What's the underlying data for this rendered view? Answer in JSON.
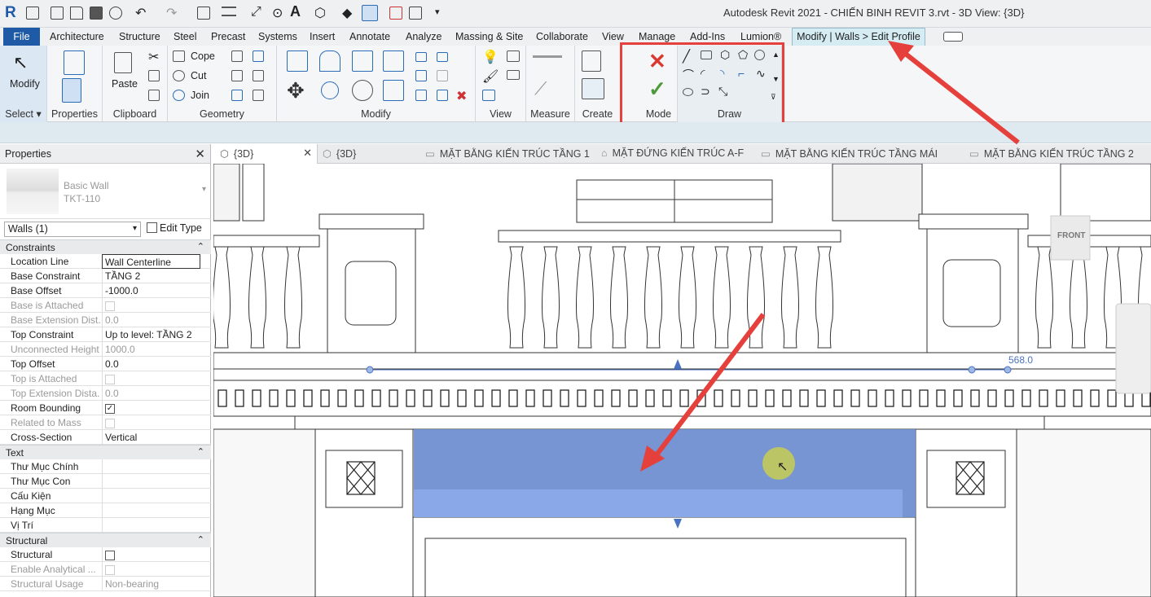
{
  "app": {
    "logo": "R",
    "title": "Autodesk Revit 2021 - CHIẾN BINH REVIT 3.rvt - 3D View: {3D}"
  },
  "ribbon_tabs": [
    "File",
    "Architecture",
    "Structure",
    "Steel",
    "Precast",
    "Systems",
    "Insert",
    "Annotate",
    "Analyze",
    "Massing & Site",
    "Collaborate",
    "View",
    "Manage",
    "Add-Ins",
    "Lumion®"
  ],
  "active_tab": "Modify | Walls > Edit Profile",
  "panels": {
    "select": {
      "modify": "Modify",
      "label": "Select ▾"
    },
    "properties": {
      "label": "Properties"
    },
    "clipboard": {
      "paste": "Paste",
      "label": "Clipboard"
    },
    "geometry": {
      "cope": "Cope",
      "cut": "Cut",
      "join": "Join",
      "label": "Geometry"
    },
    "modify": {
      "label": "Modify"
    },
    "view": {
      "label": "View"
    },
    "measure": {
      "label": "Measure"
    },
    "create": {
      "label": "Create"
    },
    "mode": {
      "label": "Mode"
    },
    "draw": {
      "label": "Draw"
    }
  },
  "properties": {
    "title": "Properties",
    "type_family": "Basic Wall",
    "type_name": "TKT-110",
    "instance": "Walls (1)",
    "edit_type": "Edit Type",
    "sections": [
      {
        "name": "Constraints",
        "rows": [
          {
            "k": "Location Line",
            "v": "Wall Centerline",
            "dis": false
          },
          {
            "k": "Base Constraint",
            "v": "TẦNG 2",
            "dis": false
          },
          {
            "k": "Base Offset",
            "v": "-1000.0",
            "dis": false
          },
          {
            "k": "Base is Attached",
            "v": "",
            "cb": true,
            "dis": true
          },
          {
            "k": "Base Extension Dist...",
            "v": "0.0",
            "dis": true
          },
          {
            "k": "Top Constraint",
            "v": "Up to level: TẦNG 2",
            "dis": false
          },
          {
            "k": "Unconnected Height",
            "v": "1000.0",
            "dis": true
          },
          {
            "k": "Top Offset",
            "v": "0.0",
            "dis": false
          },
          {
            "k": "Top is Attached",
            "v": "",
            "cb": true,
            "dis": true
          },
          {
            "k": "Top Extension Dista...",
            "v": "0.0",
            "dis": true
          },
          {
            "k": "Room Bounding",
            "v": "✓",
            "cb": true,
            "dis": false
          },
          {
            "k": "Related to Mass",
            "v": "",
            "cb": true,
            "dis": true
          },
          {
            "k": "Cross-Section",
            "v": "Vertical",
            "dis": false
          }
        ]
      },
      {
        "name": "Text",
        "rows": [
          {
            "k": "Thư Mục Chính",
            "v": "",
            "dis": false
          },
          {
            "k": "Thư Mục Con",
            "v": "",
            "dis": false
          },
          {
            "k": "Cấu Kiện",
            "v": "",
            "dis": false
          },
          {
            "k": "Hạng Mục",
            "v": "",
            "dis": false
          },
          {
            "k": "Vị Trí",
            "v": "",
            "dis": false
          }
        ]
      },
      {
        "name": "Structural",
        "rows": [
          {
            "k": "Structural",
            "v": "",
            "cb": true,
            "dis": false
          },
          {
            "k": "Enable Analytical ...",
            "v": "",
            "cb": true,
            "dis": true
          },
          {
            "k": "Structural Usage",
            "v": "Non-bearing",
            "dis": true
          }
        ]
      }
    ]
  },
  "view_tabs": [
    "{3D}",
    "{3D}",
    "MẶT BẰNG KIẾN TRÚC TẦNG 1",
    "MẶT ĐỨNG KIẾN TRÚC A-F",
    "MẶT BẰNG KIẾN TRÚC TẦNG MÁI",
    "MẶT BẰNG KIẾN TRÚC TẦNG 2"
  ],
  "viewport": {
    "dimension": "568.0",
    "viewcube": "FRONT",
    "wall_color": "#6f8fd0"
  }
}
